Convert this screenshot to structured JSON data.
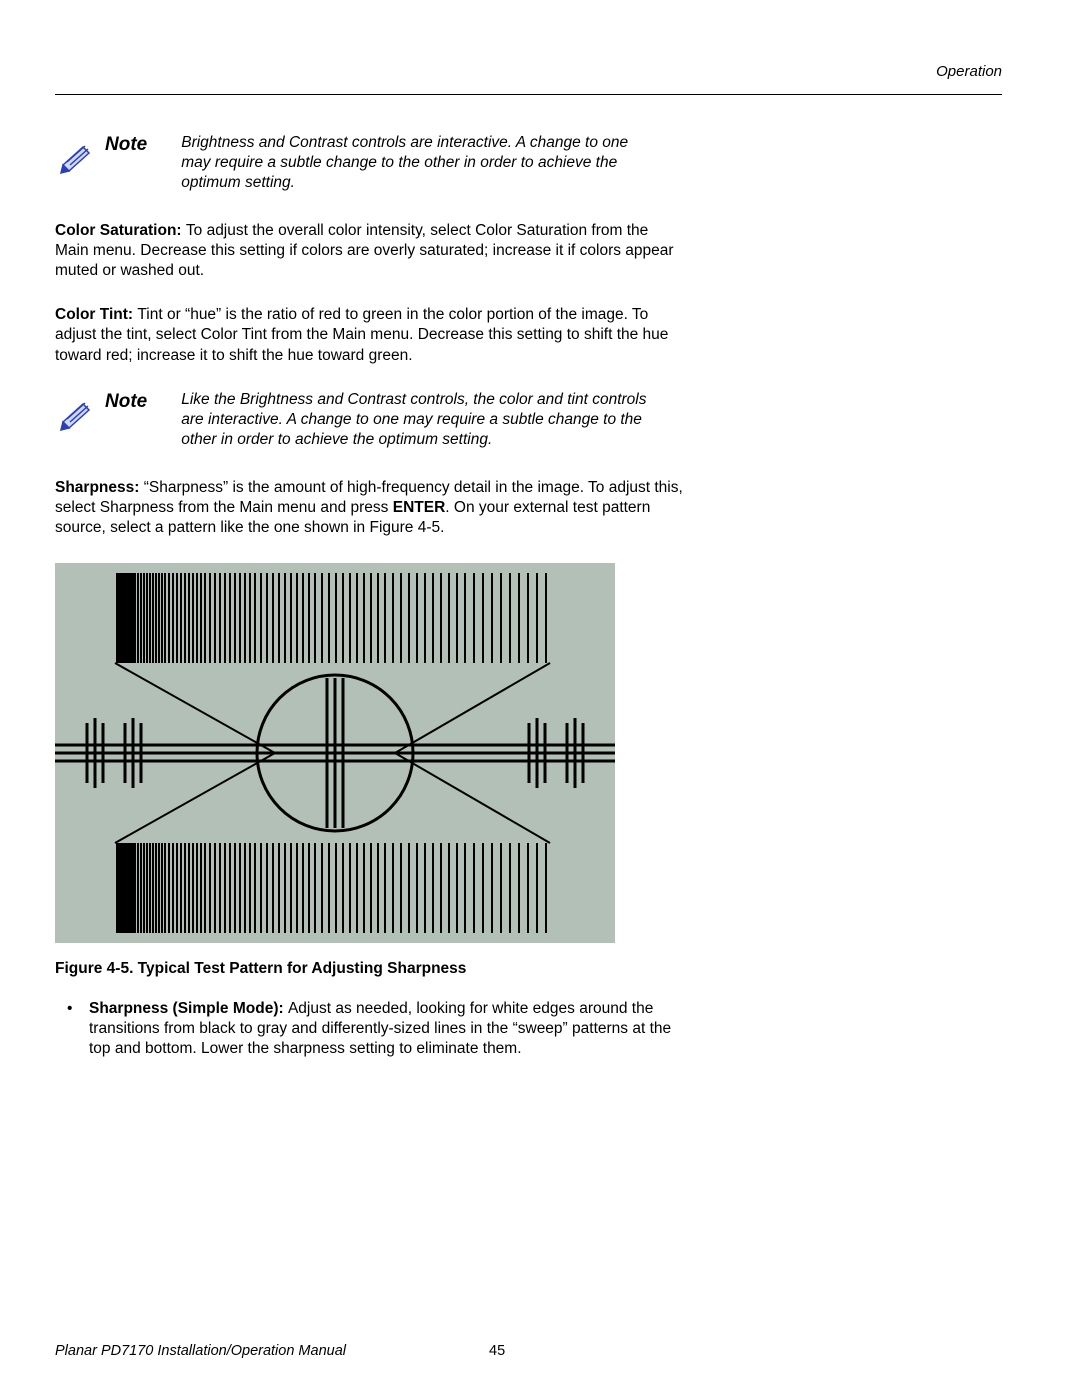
{
  "header": {
    "section": "Operation"
  },
  "note1": {
    "label": "Note",
    "text": "Brightness and Contrast controls are interactive. A change to one may require a subtle change to the other in order to achieve the optimum setting."
  },
  "color_saturation": {
    "label": "Color Saturation: ",
    "text": "To adjust the overall color intensity, select Color Saturation from the Main menu. Decrease this setting if colors are overly saturated; increase it if colors appear muted or washed out."
  },
  "color_tint": {
    "label": "Color Tint: ",
    "text": "Tint or “hue” is the ratio of red to green in the color portion of the image. To adjust the tint, select Color Tint from the Main menu. Decrease this setting to shift the hue toward red; increase it to shift the hue toward green."
  },
  "note2": {
    "label": "Note",
    "text": "Like the Brightness and Contrast controls, the color and tint controls are interactive. A change to one may require a subtle change to the other in order to achieve the optimum setting."
  },
  "sharpness": {
    "label": "Sharpness: ",
    "pre": "“Sharpness” is the amount of high-frequency detail in the image. To adjust this, select Sharpness from the Main menu and press ",
    "enter": "ENTER",
    "post": ". On your external test pattern source, select a pattern like the one shown in Figure 4-5."
  },
  "figure_caption": "Figure 4-5. Typical Test Pattern for Adjusting Sharpness",
  "bullet": {
    "mark": "•",
    "label": "Sharpness (Simple Mode): ",
    "text": "Adjust as needed, looking for white edges around the transitions from black to gray and differently-sized lines in the “sweep” patterns at the top and bottom. Lower the sharpness setting to eliminate them."
  },
  "footer": {
    "title": "Planar PD7170 Installation/Operation Manual",
    "page": "45"
  }
}
